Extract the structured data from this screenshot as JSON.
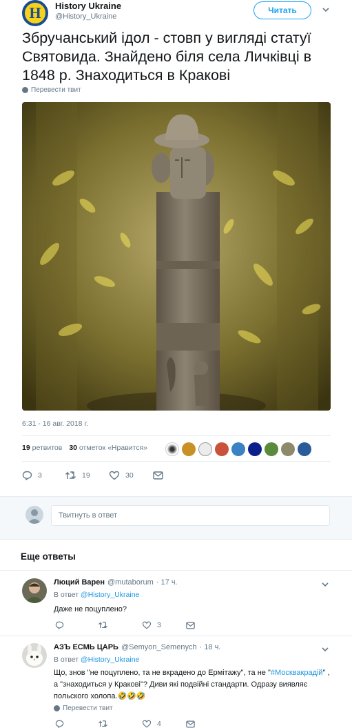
{
  "tweet": {
    "author_name": "History Ukraine",
    "author_handle": "@History_Ukraine",
    "follow_label": "Читать",
    "text": "Збручанський ідол - стовп у вигляді статуї Святовида. Знайдено біля села Личківці в 1848 р. Знаходиться в Кракові",
    "translate_label": "Перевести твит",
    "timestamp": "6:31 - 16 авг. 2018 г.",
    "retweets_count": "19",
    "retweets_label": "ретвитов",
    "likes_count": "30",
    "likes_label": "отметок «Нравится»",
    "actions": {
      "replies": "3",
      "retweets": "19",
      "likes": "30"
    }
  },
  "reply_box": {
    "placeholder": "Твитнуть в ответ"
  },
  "more_replies_title": "Еще ответы",
  "replies": [
    {
      "name": "Люций Варен",
      "handle": "@mutaborum",
      "time": "· 17 ч.",
      "in_reply_prefix": "В ответ",
      "in_reply_handle": "@History_Ukraine",
      "text": "Даже не поцуплено?",
      "likes": "3"
    },
    {
      "name": "АЗЪ ЕСМЬ ЦАРЬ",
      "handle": "@Semyon_Semenych",
      "time": "· 18 ч.",
      "in_reply_prefix": "В ответ",
      "in_reply_handle": "@History_Ukraine",
      "text_part1": "Що, знов \"не поцуплено, та не вкрадено до Ермітажу\", та не \"",
      "hashtag": "#Москвакрадій",
      "text_part2": "\" , а \"знаходиться у Кракові\"? Диви які подвійні стандарти. Одразу виявляє польского холопа.🤣🤣🤣",
      "translate_label": "Перевести твит",
      "likes": "4"
    }
  ],
  "colors": {
    "accent": "#1da1f2",
    "link": "#1b95e0",
    "muted": "#657786"
  }
}
